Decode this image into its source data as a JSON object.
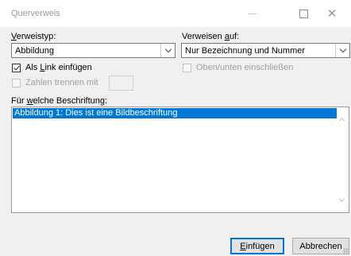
{
  "window": {
    "title": "Querverweis",
    "minimize_icon": "minimize-icon",
    "maximize_icon": "maximize-icon",
    "close_glyph": "✕"
  },
  "reference_type": {
    "label_prefix": "",
    "label_access": "V",
    "label_rest": "erweistyp:",
    "value": "Abbildung"
  },
  "reference_to": {
    "label_prefix": "Verweisen ",
    "label_access": "a",
    "label_rest": "uf:",
    "value": "Nur Bezeichnung und Nummer"
  },
  "insert_as_link": {
    "checked": true,
    "label_prefix": "Als ",
    "label_access": "L",
    "label_rest": "ink einfügen"
  },
  "above_below": {
    "checked": false,
    "enabled": false,
    "label": "Oben/unten einschließen"
  },
  "separate_numbers": {
    "checked": false,
    "enabled": false,
    "label": "Zahlen trennen mit",
    "value": ""
  },
  "for_which_caption": {
    "label_prefix": "Für ",
    "label_access": "w",
    "label_rest": "elche Beschriftung:",
    "items": [
      "Abbildung 1: Dies ist eine Bildbeschriftung"
    ],
    "selected_index": 0
  },
  "buttons": {
    "insert_access": "E",
    "insert_rest": "infügen",
    "cancel": "Abbrechen"
  }
}
